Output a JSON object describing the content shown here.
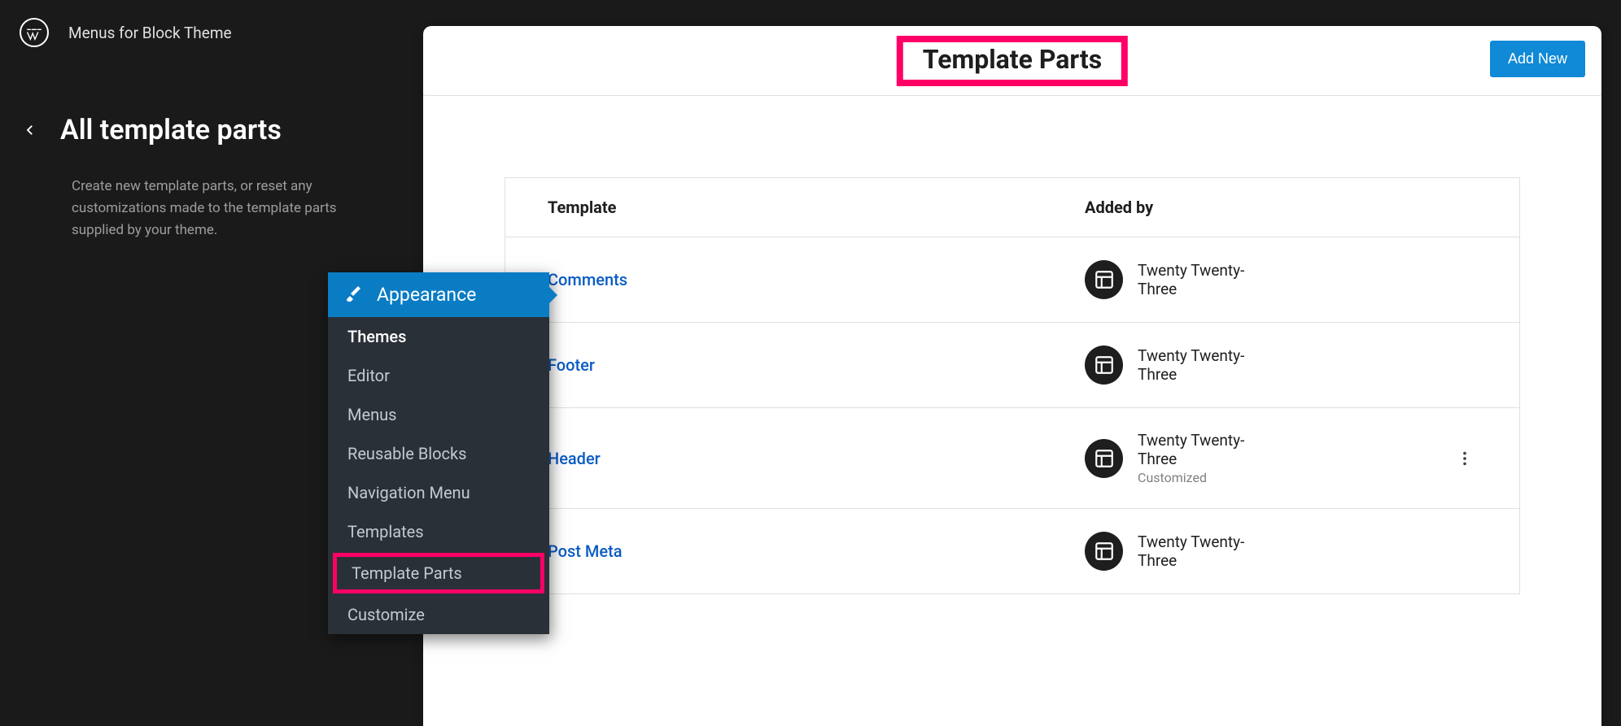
{
  "topbar": {
    "site_title": "Menus for Block Theme"
  },
  "sidebar": {
    "title": "All template parts",
    "description": "Create new template parts, or reset any customizations made to the template parts supplied by your theme."
  },
  "main": {
    "page_title": "Template Parts",
    "add_new_label": "Add New",
    "columns": {
      "template": "Template",
      "added_by": "Added by"
    },
    "rows": [
      {
        "name": "Comments",
        "added_by": "Twenty Twenty-Three",
        "customized": "",
        "show_dots": false
      },
      {
        "name": "Footer",
        "added_by": "Twenty Twenty-Three",
        "customized": "",
        "show_dots": false
      },
      {
        "name": "Header",
        "added_by": "Twenty Twenty-Three",
        "customized": "Customized",
        "show_dots": true
      },
      {
        "name": "Post Meta",
        "added_by": "Twenty Twenty-Three",
        "customized": "",
        "show_dots": false
      }
    ]
  },
  "flyout": {
    "header": "Appearance",
    "items": [
      {
        "label": "Themes",
        "current": true,
        "highlighted": false
      },
      {
        "label": "Editor",
        "current": false,
        "highlighted": false
      },
      {
        "label": "Menus",
        "current": false,
        "highlighted": false
      },
      {
        "label": "Reusable Blocks",
        "current": false,
        "highlighted": false
      },
      {
        "label": "Navigation Menu",
        "current": false,
        "highlighted": false
      },
      {
        "label": "Templates",
        "current": false,
        "highlighted": false
      },
      {
        "label": "Template Parts",
        "current": false,
        "highlighted": true
      },
      {
        "label": "Customize",
        "current": false,
        "highlighted": false
      }
    ]
  }
}
